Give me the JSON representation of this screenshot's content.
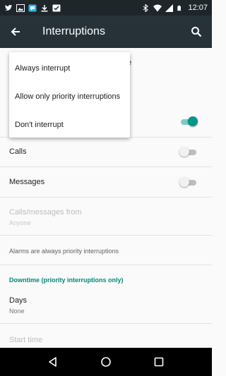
{
  "status_bar": {
    "time": "12:07",
    "left_icons": [
      "twitter-icon",
      "image-icon",
      "chat-icon",
      "download-icon",
      "checkbox-icon"
    ],
    "right_icons": [
      "bluetooth-icon",
      "wifi-icon",
      "signal-icon",
      "battery-icon"
    ]
  },
  "app_bar": {
    "title": "Interruptions",
    "background": "#263238"
  },
  "popup_menu": {
    "items": [
      {
        "label": "Always interrupt"
      },
      {
        "label": "Allow only priority interruptions"
      },
      {
        "label": "Don't interrupt"
      }
    ]
  },
  "settings": {
    "hidden_fragment": "e",
    "events_toggle_on": true,
    "calls": {
      "label": "Calls",
      "toggle_on": false
    },
    "messages": {
      "label": "Messages",
      "toggle_on": false
    },
    "calls_messages_from": {
      "label": "Calls/messages from",
      "value": "Anyone"
    },
    "alarms_note": "Alarms are always priority interruptions",
    "downtime_header": "Downtime (priority interruptions only)",
    "days": {
      "label": "Days",
      "value": "None"
    },
    "start_time": {
      "label": "Start time"
    }
  },
  "colors": {
    "accent": "#009688",
    "accent_track": "#80cbc4",
    "section_header": "#00897b"
  },
  "nav_bar": {
    "buttons": [
      "back-triangle-icon",
      "home-circle-icon",
      "recents-square-icon"
    ]
  }
}
